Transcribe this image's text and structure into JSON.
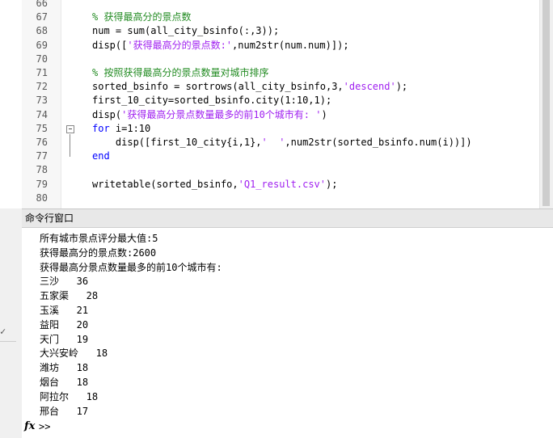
{
  "editor": {
    "lines": [
      {
        "n": "66",
        "parts": []
      },
      {
        "n": "67",
        "parts": [
          {
            "c": "cmt",
            "t": "% 获得最高分的景点数"
          }
        ]
      },
      {
        "n": "68",
        "parts": [
          {
            "c": "",
            "t": "num = sum(all_city_bsinfo(:,3));"
          }
        ]
      },
      {
        "n": "69",
        "parts": [
          {
            "c": "",
            "t": "disp(["
          },
          {
            "c": "str",
            "t": "'获得最高分的景点数:'"
          },
          {
            "c": "",
            "t": ",num2str(num.num)]);"
          }
        ]
      },
      {
        "n": "70",
        "parts": []
      },
      {
        "n": "71",
        "parts": [
          {
            "c": "cmt",
            "t": "% 按照获得最高分的景点数量对城市排序"
          }
        ]
      },
      {
        "n": "72",
        "parts": [
          {
            "c": "",
            "t": "sorted_bsinfo = sortrows(all_city_bsinfo,3,"
          },
          {
            "c": "str",
            "t": "'descend'"
          },
          {
            "c": "",
            "t": ");"
          }
        ]
      },
      {
        "n": "73",
        "parts": [
          {
            "c": "",
            "t": "first_10_city=sorted_bsinfo.city(1:10,1);"
          }
        ]
      },
      {
        "n": "74",
        "parts": [
          {
            "c": "",
            "t": "disp("
          },
          {
            "c": "str",
            "t": "'获得最高分景点数量最多的前10个城市有: '"
          },
          {
            "c": "",
            "t": ")"
          }
        ]
      },
      {
        "n": "75",
        "parts": [
          {
            "c": "kw",
            "t": "for"
          },
          {
            "c": "",
            "t": " i=1:10"
          }
        ]
      },
      {
        "n": "76",
        "parts": [
          {
            "c": "",
            "t": "    disp([first_10_city{i,1},"
          },
          {
            "c": "str",
            "t": "'  '"
          },
          {
            "c": "",
            "t": ",num2str(sorted_bsinfo.num(i))])"
          }
        ]
      },
      {
        "n": "77",
        "parts": [
          {
            "c": "kw",
            "t": "end"
          }
        ]
      },
      {
        "n": "78",
        "parts": []
      },
      {
        "n": "79",
        "parts": [
          {
            "c": "",
            "t": "writetable(sorted_bsinfo,"
          },
          {
            "c": "str",
            "t": "'Q1_result.csv'"
          },
          {
            "c": "",
            "t": ");"
          }
        ]
      },
      {
        "n": "80",
        "parts": []
      }
    ]
  },
  "command_window": {
    "title": "命令行窗口",
    "output": [
      "所有城市景点评分最大值:5",
      "获得最高分的景点数:2600",
      "获得最高分景点数量最多的前10个城市有:",
      "三沙   36",
      "五家渠   28",
      "玉溪   21",
      "益阳   20",
      "天门   19",
      "大兴安岭   18",
      "潍坊   18",
      "烟台   18",
      "阿拉尔   18",
      "邢台   17"
    ],
    "fx_label": "fx",
    "prompt": ">>"
  }
}
